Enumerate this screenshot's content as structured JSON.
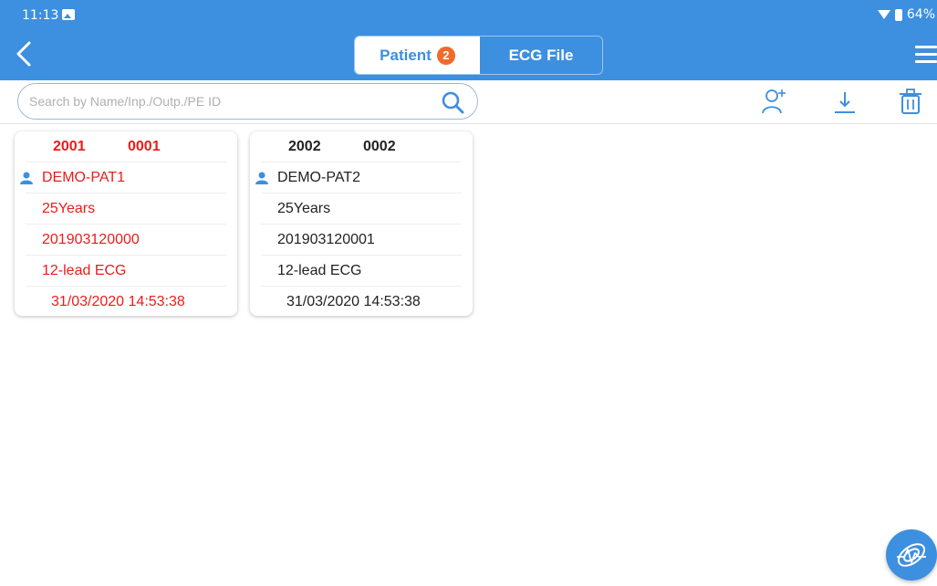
{
  "status_bar": {
    "time": "11:13",
    "battery": "64%"
  },
  "header": {
    "tabs": [
      {
        "label": "Patient",
        "badge": "2",
        "active": true
      },
      {
        "label": "ECG File",
        "active": false
      }
    ]
  },
  "search": {
    "placeholder": "Search by Name/Inp./Outp./PE ID",
    "value": ""
  },
  "toolbar": {
    "icons": [
      "add-patient-icon",
      "download-icon",
      "delete-icon"
    ]
  },
  "patients": [
    {
      "id_a": "2001",
      "id_b": "0001",
      "name": "DEMO-PAT1",
      "age": "25Years",
      "number": "201903120000",
      "exam": "12-lead ECG",
      "datetime": "31/03/2020 14:53:38",
      "selected": true
    },
    {
      "id_a": "2002",
      "id_b": "0002",
      "name": "DEMO-PAT2",
      "age": "25Years",
      "number": "201903120001",
      "exam": "12-lead ECG",
      "datetime": "31/03/2020 14:53:38",
      "selected": false
    }
  ],
  "colors": {
    "primary": "#3d8fe0",
    "selected_text": "#ee1b1b",
    "badge": "#ef6a2c"
  }
}
